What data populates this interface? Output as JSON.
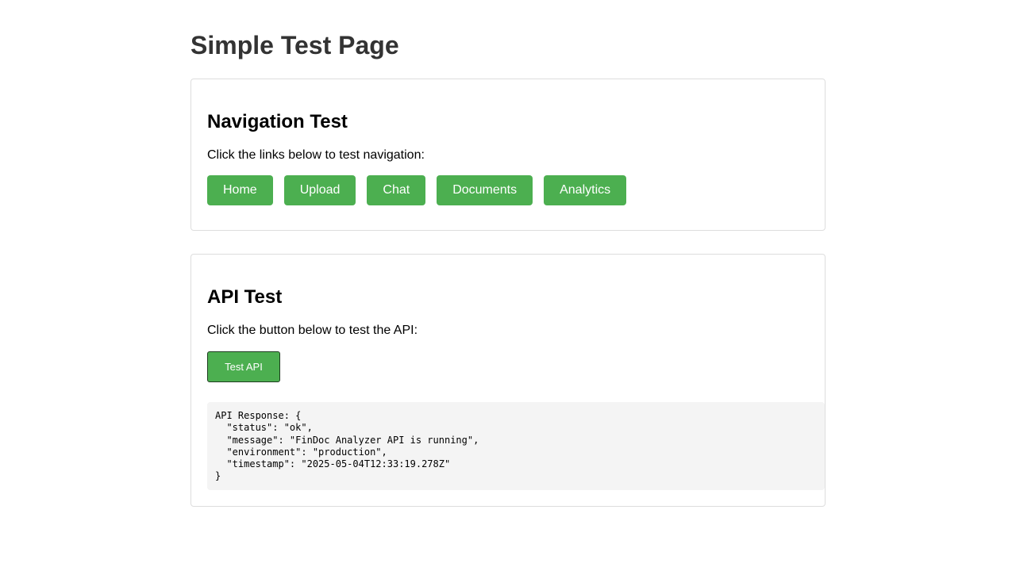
{
  "page": {
    "title": "Simple Test Page"
  },
  "navigation_section": {
    "heading": "Navigation Test",
    "description": "Click the links below to test navigation:",
    "links": [
      {
        "label": "Home"
      },
      {
        "label": "Upload"
      },
      {
        "label": "Chat"
      },
      {
        "label": "Documents"
      },
      {
        "label": "Analytics"
      }
    ]
  },
  "api_section": {
    "heading": "API Test",
    "description": "Click the button below to test the API:",
    "button_label": "Test API",
    "response_text": "API Response: {\n  \"status\": \"ok\",\n  \"message\": \"FinDoc Analyzer API is running\",\n  \"environment\": \"production\",\n  \"timestamp\": \"2025-05-04T12:33:19.278Z\"\n}"
  },
  "colors": {
    "accent": "#4caf50",
    "title_text": "#333333",
    "card_border": "#dddddd",
    "response_background": "#f4f4f4"
  }
}
